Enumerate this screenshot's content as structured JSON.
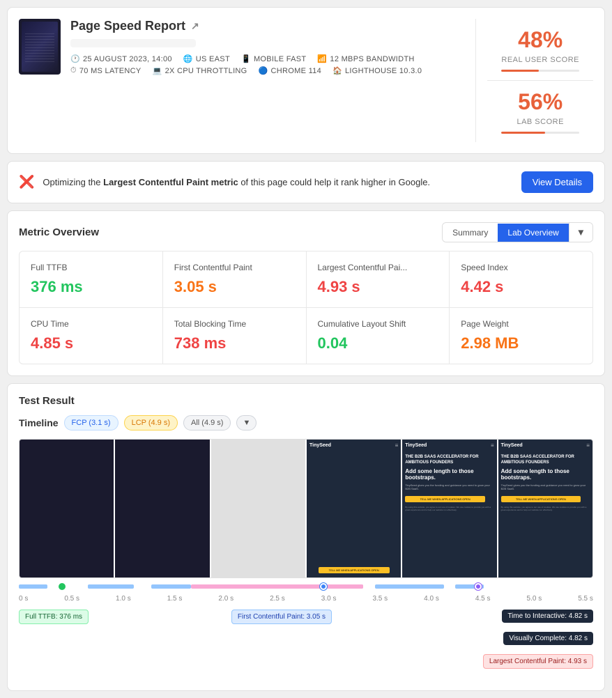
{
  "header": {
    "title": "Page Speed Report",
    "thumbnail_alt": "Page thumbnail",
    "metadata": {
      "date": "25 AUGUST 2023, 14:00",
      "location": "US EAST",
      "connection": "MOBILE FAST",
      "bandwidth": "12 MBPS BANDWIDTH",
      "latency": "70 MS LATENCY",
      "cpu": "2X CPU THROTTLING",
      "browser": "CHROME 114",
      "lighthouse": "LIGHTHOUSE 10.3.0"
    },
    "scores": {
      "real_user": {
        "value": "48%",
        "label": "REAL USER SCORE",
        "fill": 48
      },
      "lab": {
        "value": "56%",
        "label": "LAB SCORE",
        "fill": 56
      }
    }
  },
  "alert": {
    "text_prefix": "Optimizing the ",
    "highlight": "Largest Contentful Paint metric",
    "text_suffix": " of this page could help it rank higher in Google.",
    "button_label": "View Details"
  },
  "metric_overview": {
    "title": "Metric Overview",
    "toggle": {
      "summary_label": "Summary",
      "lab_label": "Lab Overview"
    },
    "metrics": [
      {
        "name": "Full TTFB",
        "value": "376 ms",
        "color": "green"
      },
      {
        "name": "First Contentful Paint",
        "value": "3.05 s",
        "color": "orange"
      },
      {
        "name": "Largest Contentful Pai...",
        "value": "4.93 s",
        "color": "red"
      },
      {
        "name": "Speed Index",
        "value": "4.42 s",
        "color": "red"
      },
      {
        "name": "CPU Time",
        "value": "4.85 s",
        "color": "red"
      },
      {
        "name": "Total Blocking Time",
        "value": "738 ms",
        "color": "red"
      },
      {
        "name": "Cumulative Layout Shift",
        "value": "0.04",
        "color": "green"
      },
      {
        "name": "Page Weight",
        "value": "2.98 MB",
        "color": "orange"
      }
    ]
  },
  "test_result": {
    "title": "Test Result",
    "timeline": {
      "label": "Timeline",
      "tags": [
        {
          "id": "fcp",
          "label": "FCP (3.1 s)",
          "type": "fcp"
        },
        {
          "id": "lcp",
          "label": "LCP (4.9 s)",
          "type": "lcp"
        },
        {
          "id": "all",
          "label": "All (4.9 s)",
          "type": "all"
        }
      ]
    },
    "time_marks": [
      "0 s",
      "0.5 s",
      "1.0 s",
      "1.5 s",
      "2.0 s",
      "2.5 s",
      "3.0 s",
      "3.5 s",
      "4.0 s",
      "4.5 s",
      "5.0 s",
      "5.5 s"
    ],
    "annotations": [
      {
        "label": "Full TTFB: 376 ms",
        "color": "green",
        "left": "0%"
      },
      {
        "label": "First Contentful Paint: 3.05 s",
        "color": "blue",
        "left": "42%"
      },
      {
        "label": "Time to Interactive: 4.82 s",
        "color": "dark",
        "left": "62%"
      },
      {
        "label": "Visually Complete: 4.82 s",
        "color": "dark",
        "left": "62%"
      },
      {
        "label": "Largest Contentful Paint: 4.93 s",
        "color": "red",
        "left": "62%"
      }
    ]
  }
}
